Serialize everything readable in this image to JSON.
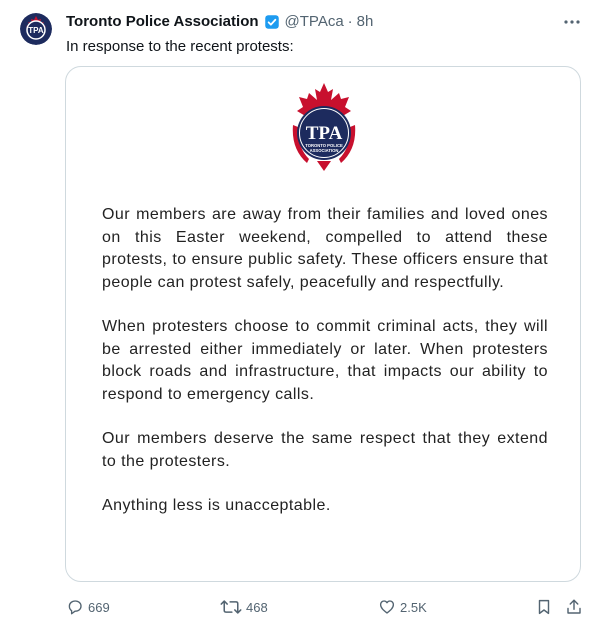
{
  "tweet": {
    "author_name": "Toronto Police Association",
    "handle": "@TPAca",
    "separator": "·",
    "time": "8h",
    "text": "In response to the recent protests:"
  },
  "avatar": {
    "initials": "TPA"
  },
  "media": {
    "logo": {
      "initials": "TPA",
      "org_line1": "TORONTO POLICE",
      "org_line2": "ASSOCIATION",
      "colors": {
        "navy": "#1d2b5e",
        "red": "#c8102e"
      }
    },
    "paragraphs": [
      "Our members are away from their families and loved ones on this Easter weekend, compelled to attend these protests, to ensure public safety. These officers ensure that people can protest safely, peacefully and respectfully.",
      "When protesters choose to commit criminal acts, they will be arrested either immediately or later. When protesters block roads and infrastructure, that impacts our ability to respond to emergency calls.",
      "Our members deserve the same respect that they extend to the protesters.",
      "Anything less is unacceptable."
    ]
  },
  "actions": {
    "replies": "669",
    "reposts": "468",
    "likes": "2.5K"
  },
  "colors": {
    "verified": "#1d9bf0",
    "muted": "#536471",
    "border": "#cfd9de"
  }
}
